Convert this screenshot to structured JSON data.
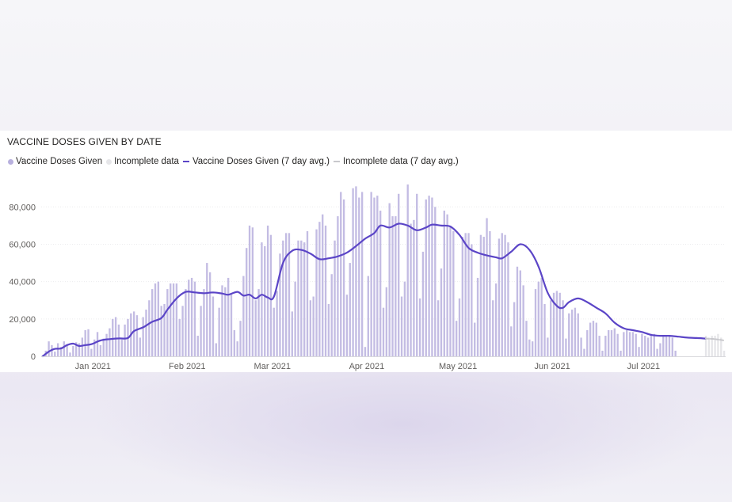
{
  "chart_data": {
    "type": "bar",
    "title": "VACCINE DOSES GIVEN BY DATE",
    "legend_position": "top-left",
    "grid": true,
    "colors": {
      "doses": "#c3bce3",
      "incomplete": "#e6e6e9",
      "avg": "#5b45c7",
      "avg_incomplete": "#c8c8cc"
    },
    "legend": [
      {
        "label": "Vaccine Doses Given",
        "kind": "dot",
        "color": "#b8b0de"
      },
      {
        "label": "Incomplete data",
        "kind": "dot",
        "color": "#e6e6e9"
      },
      {
        "label": "Vaccine Doses Given (7 day avg.)",
        "kind": "line",
        "color": "#5b45c7"
      },
      {
        "label": "Incomplete data (7 day avg.)",
        "kind": "line",
        "color": "#c8c8cc"
      }
    ],
    "y_ticks": [
      "0",
      "20,000",
      "40,000",
      "60,000",
      "80,000"
    ],
    "y_tick_values": [
      0,
      20000,
      40000,
      60000,
      80000
    ],
    "ylim": [
      0,
      92000
    ],
    "x_range": [
      "2020-12-15",
      "2021-07-27"
    ],
    "x_ticks": [
      {
        "label": "Jan 2021",
        "date": "2021-01-01"
      },
      {
        "label": "Feb 2021",
        "date": "2021-02-01"
      },
      {
        "label": "Mar 2021",
        "date": "2021-03-01"
      },
      {
        "label": "Apr 2021",
        "date": "2021-04-01"
      },
      {
        "label": "May 2021",
        "date": "2021-05-01"
      },
      {
        "label": "Jun 2021",
        "date": "2021-06-01"
      },
      {
        "label": "Jul 2021",
        "date": "2021-07-01"
      }
    ],
    "series": [
      {
        "name": "Vaccine Doses Given",
        "type": "bar",
        "start_date": "2020-12-15",
        "values": [
          600,
          3000,
          8000,
          6000,
          2500,
          7000,
          5000,
          8000,
          6000,
          2000,
          5500,
          7500,
          7000,
          10000,
          14000,
          14500,
          4000,
          9000,
          13000,
          6000,
          9500,
          12000,
          15000,
          20000,
          21000,
          17000,
          9000,
          17000,
          20000,
          23000,
          24000,
          22000,
          10000,
          21000,
          25000,
          30000,
          36000,
          39000,
          40000,
          27000,
          28000,
          36000,
          39000,
          39000,
          39000,
          20000,
          27000,
          36000,
          41000,
          42000,
          40000,
          11000,
          27000,
          36000,
          50000,
          45000,
          32000,
          7000,
          26000,
          38000,
          37000,
          42000,
          33000,
          14000,
          8000,
          19000,
          43000,
          58000,
          70000,
          69000,
          30000,
          36000,
          61000,
          59000,
          70000,
          65000,
          26000,
          35000,
          55000,
          62000,
          66000,
          66000,
          24000,
          40000,
          62000,
          62000,
          61000,
          67000,
          30000,
          32000,
          68000,
          72000,
          76000,
          70000,
          28000,
          44000,
          62000,
          75000,
          88000,
          84000,
          33000,
          50000,
          90000,
          91000,
          85000,
          88000,
          5000,
          43000,
          88000,
          85000,
          86000,
          78000,
          26000,
          37000,
          82000,
          75000,
          75000,
          87000,
          32000,
          40000,
          92000,
          71000,
          73000,
          87000,
          31000,
          56000,
          84000,
          86000,
          85000,
          80000,
          30000,
          47000,
          78000,
          76000,
          70000,
          67000,
          19000,
          31000,
          64000,
          66000,
          66000,
          60000,
          18000,
          42000,
          65000,
          64000,
          74000,
          67000,
          30000,
          39000,
          63000,
          66000,
          65000,
          61000,
          16000,
          29000,
          48000,
          46000,
          38000,
          19000,
          9000,
          8000,
          36000,
          40000,
          42000,
          28000,
          10000,
          30000,
          34000,
          35000,
          34000,
          30000,
          9500,
          23000,
          25000,
          26000,
          23000,
          10000,
          4000,
          14000,
          18000,
          19000,
          18000,
          11000,
          3000,
          11000,
          14000,
          14000,
          15000,
          12000,
          3000,
          13000,
          14000,
          13000,
          13000,
          12000,
          5000,
          12000,
          11000,
          10000,
          12000,
          12000,
          4000,
          7000,
          11000,
          11000,
          11000,
          10000,
          3000
        ]
      },
      {
        "name": "Incomplete data",
        "type": "bar",
        "start_date": "2021-07-21",
        "values": [
          11000,
          10000,
          11000,
          11000,
          12000,
          10000,
          3000
        ]
      },
      {
        "name": "Vaccine Doses Given (7 day avg.)",
        "type": "line",
        "points": [
          [
            "2020-12-15",
            0
          ],
          [
            "2020-12-17",
            2500
          ],
          [
            "2020-12-19",
            4000
          ],
          [
            "2020-12-21",
            4200
          ],
          [
            "2020-12-23",
            6000
          ],
          [
            "2020-12-25",
            6800
          ],
          [
            "2020-12-27",
            5500
          ],
          [
            "2020-12-29",
            6000
          ],
          [
            "2020-12-31",
            6500
          ],
          [
            "2021-01-03",
            8500
          ],
          [
            "2021-01-06",
            9200
          ],
          [
            "2021-01-09",
            9600
          ],
          [
            "2021-01-12",
            9800
          ],
          [
            "2021-01-14",
            13500
          ],
          [
            "2021-01-17",
            15500
          ],
          [
            "2021-01-20",
            18500
          ],
          [
            "2021-01-23",
            20500
          ],
          [
            "2021-01-25",
            25000
          ],
          [
            "2021-01-28",
            31000
          ],
          [
            "2021-01-31",
            34500
          ],
          [
            "2021-02-03",
            34200
          ],
          [
            "2021-02-06",
            33800
          ],
          [
            "2021-02-09",
            34200
          ],
          [
            "2021-02-12",
            33600
          ],
          [
            "2021-02-14",
            33000
          ],
          [
            "2021-02-17",
            34500
          ],
          [
            "2021-02-19",
            32500
          ],
          [
            "2021-02-21",
            33000
          ],
          [
            "2021-02-23",
            31000
          ],
          [
            "2021-02-25",
            33000
          ],
          [
            "2021-02-27",
            31500
          ],
          [
            "2021-03-01",
            32000
          ],
          [
            "2021-03-04",
            50000
          ],
          [
            "2021-03-07",
            56500
          ],
          [
            "2021-03-10",
            57000
          ],
          [
            "2021-03-13",
            55000
          ],
          [
            "2021-03-16",
            52000
          ],
          [
            "2021-03-19",
            52500
          ],
          [
            "2021-03-22",
            53500
          ],
          [
            "2021-03-25",
            55500
          ],
          [
            "2021-03-28",
            59000
          ],
          [
            "2021-03-31",
            63000
          ],
          [
            "2021-04-03",
            66000
          ],
          [
            "2021-04-05",
            70000
          ],
          [
            "2021-04-08",
            69000
          ],
          [
            "2021-04-11",
            71000
          ],
          [
            "2021-04-14",
            70000
          ],
          [
            "2021-04-17",
            67500
          ],
          [
            "2021-04-20",
            69000
          ],
          [
            "2021-04-22",
            70500
          ],
          [
            "2021-04-25",
            70000
          ],
          [
            "2021-04-28",
            69500
          ],
          [
            "2021-05-01",
            65000
          ],
          [
            "2021-05-04",
            58000
          ],
          [
            "2021-05-07",
            55500
          ],
          [
            "2021-05-10",
            54000
          ],
          [
            "2021-05-13",
            53000
          ],
          [
            "2021-05-15",
            52500
          ],
          [
            "2021-05-18",
            56000
          ],
          [
            "2021-05-21",
            60000
          ],
          [
            "2021-05-24",
            57000
          ],
          [
            "2021-05-27",
            48000
          ],
          [
            "2021-05-30",
            34000
          ],
          [
            "2021-06-02",
            27000
          ],
          [
            "2021-06-04",
            26000
          ],
          [
            "2021-06-06",
            29000
          ],
          [
            "2021-06-09",
            31000
          ],
          [
            "2021-06-12",
            29000
          ],
          [
            "2021-06-15",
            26000
          ],
          [
            "2021-06-18",
            23000
          ],
          [
            "2021-06-21",
            18000
          ],
          [
            "2021-06-24",
            15000
          ],
          [
            "2021-06-27",
            14000
          ],
          [
            "2021-06-30",
            13000
          ],
          [
            "2021-07-03",
            11500
          ],
          [
            "2021-07-06",
            11000
          ],
          [
            "2021-07-09",
            11000
          ],
          [
            "2021-07-12",
            10500
          ],
          [
            "2021-07-15",
            10000
          ],
          [
            "2021-07-18",
            9800
          ],
          [
            "2021-07-21",
            9500
          ]
        ]
      },
      {
        "name": "Incomplete data (7 day avg.)",
        "type": "line",
        "points": [
          [
            "2021-07-21",
            9500
          ],
          [
            "2021-07-24",
            9200
          ],
          [
            "2021-07-27",
            8500
          ]
        ]
      }
    ]
  }
}
